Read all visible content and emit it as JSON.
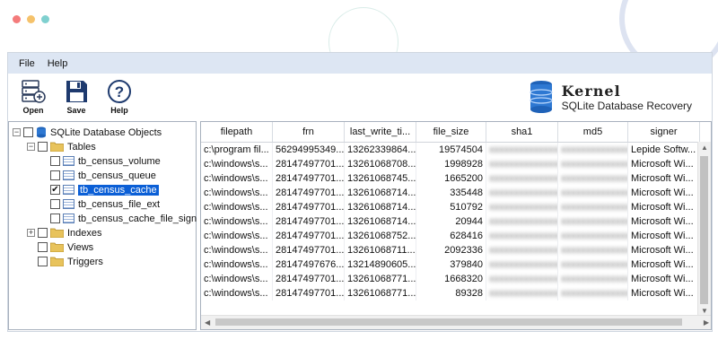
{
  "window": {
    "dot_colors": [
      "#f47b7b",
      "#f5c26b",
      "#7fd0cf"
    ]
  },
  "menu": {
    "items": [
      "File",
      "Help"
    ]
  },
  "toolbar": {
    "open_label": "Open",
    "save_label": "Save",
    "help_label": "Help"
  },
  "brand": {
    "name": "Kernel",
    "product": "SQLite Database Recovery"
  },
  "tree": {
    "root": "SQLite Database Objects",
    "tables_label": "Tables",
    "tables": [
      "tb_census_volume",
      "tb_census_queue",
      "tb_census_cache",
      "tb_census_file_ext",
      "tb_census_cache_file_sign"
    ],
    "selected_table": "tb_census_cache",
    "indexes_label": "Indexes",
    "views_label": "Views",
    "triggers_label": "Triggers"
  },
  "grid": {
    "columns": [
      "filepath",
      "frn",
      "last_write_ti...",
      "file_size",
      "sha1",
      "md5",
      "signer"
    ],
    "rows": [
      [
        "c:\\program fil...",
        "56294995349...",
        "13262339864...",
        "19574504",
        "xxxxxxxxxxxxxxxx",
        "xxxxxxxxxxxxxx",
        "Lepide Softw..."
      ],
      [
        "c:\\windows\\s...",
        "28147497701...",
        "13261068708...",
        "1998928",
        "xxxxxxxxxxxxxxxx",
        "xxxxxxxxxxxxxx",
        "Microsoft Wi..."
      ],
      [
        "c:\\windows\\s...",
        "28147497701...",
        "13261068745...",
        "1665200",
        "xxxxxxxxxxxxxxxx",
        "xxxxxxxxxxxxxx",
        "Microsoft Wi..."
      ],
      [
        "c:\\windows\\s...",
        "28147497701...",
        "13261068714...",
        "335448",
        "xxxxxxxxxxxxxxxx",
        "xxxxxxxxxxxxxx",
        "Microsoft Wi..."
      ],
      [
        "c:\\windows\\s...",
        "28147497701...",
        "13261068714...",
        "510792",
        "xxxxxxxxxxxxxxxx",
        "xxxxxxxxxxxxxx",
        "Microsoft Wi..."
      ],
      [
        "c:\\windows\\s...",
        "28147497701...",
        "13261068714...",
        "20944",
        "xxxxxxxxxxxxxxxx",
        "xxxxxxxxxxxxxx",
        "Microsoft Wi..."
      ],
      [
        "c:\\windows\\s...",
        "28147497701...",
        "13261068752...",
        "628416",
        "xxxxxxxxxxxxxxxx",
        "xxxxxxxxxxxxxx",
        "Microsoft Wi..."
      ],
      [
        "c:\\windows\\s...",
        "28147497701...",
        "13261068711...",
        "2092336",
        "xxxxxxxxxxxxxxxx",
        "xxxxxxxxxxxxxx",
        "Microsoft Wi..."
      ],
      [
        "c:\\windows\\s...",
        "28147497676...",
        "13214890605...",
        "379840",
        "xxxxxxxxxxxxxxxx",
        "xxxxxxxxxxxxxx",
        "Microsoft Wi..."
      ],
      [
        "c:\\windows\\s...",
        "28147497701...",
        "13261068771...",
        "1668320",
        "xxxxxxxxxxxxxxxx",
        "xxxxxxxxxxxxxx",
        "Microsoft Wi..."
      ],
      [
        "c:\\windows\\s...",
        "28147497701...",
        "13261068771...",
        "89328",
        "xxxxxxxxxxxxxxxx",
        "xxxxxxxxxxxxxx",
        "Microsoft Wi..."
      ]
    ]
  }
}
